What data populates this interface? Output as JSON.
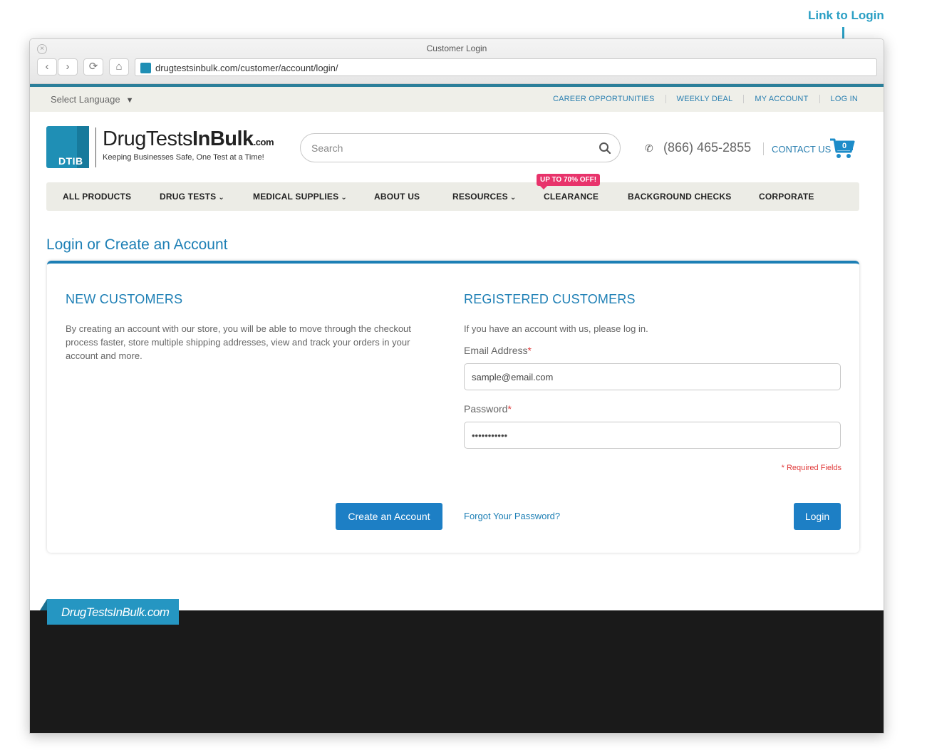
{
  "annotation": {
    "label": "Link to Login"
  },
  "window": {
    "title": "Customer Login",
    "url": "drugtestsinbulk.com/customer/account/login/",
    "close_glyph": "×",
    "back_glyph": "‹",
    "forward_glyph": "›",
    "reload_glyph": "⟳",
    "home_glyph": "⌂"
  },
  "topbar": {
    "language": "Select Language",
    "language_arrow": "▼",
    "links": [
      "CAREER OPPORTUNITIES",
      "WEEKLY DEAL",
      "MY ACCOUNT",
      "LOG IN"
    ]
  },
  "header": {
    "logo_badge": "DTIB",
    "logo_light": "DrugTests",
    "logo_bold": "InBulk",
    "logo_suffix": ".com",
    "tagline": "Keeping Businesses Safe, One Test at a Time!",
    "search_placeholder": "Search",
    "phone_glyph": "✆",
    "phone": "(866) 465-2855",
    "contact": "CONTACT US",
    "cart_count": "0"
  },
  "nav": {
    "items": [
      {
        "label": "ALL PRODUCTS",
        "chev": ""
      },
      {
        "label": "DRUG TESTS",
        "chev": "⌄"
      },
      {
        "label": "MEDICAL SUPPLIES",
        "chev": "⌄"
      },
      {
        "label": "ABOUT US",
        "chev": ""
      },
      {
        "label": "RESOURCES",
        "chev": "⌄"
      },
      {
        "label": "CLEARANCE",
        "chev": ""
      },
      {
        "label": "BACKGROUND CHECKS",
        "chev": ""
      },
      {
        "label": "CORPORATE",
        "chev": ""
      }
    ],
    "badge": "UP TO 70% OFF!"
  },
  "page": {
    "title": "Login or Create an Account",
    "new_customers": {
      "heading": "NEW CUSTOMERS",
      "text": "By creating an account with our store, you will be able to move through the checkout process faster, store multiple shipping addresses, view and track your orders in your account and more.",
      "button": "Create an Account"
    },
    "registered": {
      "heading": "REGISTERED CUSTOMERS",
      "intro": "If you have an account with us, please log in.",
      "email_label": "Email Address",
      "email_value": "sample@email.com",
      "password_label": "Password",
      "password_value": "•••••••••••",
      "required_mark": "*",
      "required_note": "* Required Fields",
      "forgot": "Forgot Your Password?",
      "login_button": "Login"
    }
  },
  "footer": {
    "brand": "DrugTestsInBulk.com"
  },
  "colors": {
    "brand_blue": "#1d7fb5",
    "button_blue": "#1d7fc5",
    "sale_pink": "#e8336b",
    "footer_dark": "#1a1a1a"
  }
}
